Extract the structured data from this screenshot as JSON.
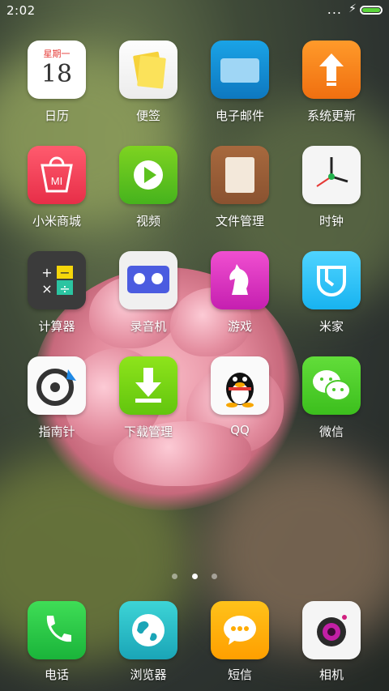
{
  "status_bar": {
    "time": "2:02",
    "signal_dots": "...",
    "charging_symbol": "⚡",
    "battery_level": 1.0,
    "battery_color": "#5bd43b"
  },
  "calendar_icon": {
    "weekday": "星期一",
    "day": "18"
  },
  "apps": [
    {
      "label": "日历"
    },
    {
      "label": "便签"
    },
    {
      "label": "电子邮件"
    },
    {
      "label": "系统更新"
    },
    {
      "label": "小米商城"
    },
    {
      "label": "视频"
    },
    {
      "label": "文件管理"
    },
    {
      "label": "时钟"
    },
    {
      "label": "计算器"
    },
    {
      "label": "录音机"
    },
    {
      "label": "游戏"
    },
    {
      "label": "米家"
    },
    {
      "label": "指南针"
    },
    {
      "label": "下载管理"
    },
    {
      "label": "QQ"
    },
    {
      "label": "微信"
    }
  ],
  "pager": {
    "count": 3,
    "active_index": 1
  },
  "dock": [
    {
      "label": "电话"
    },
    {
      "label": "浏览器"
    },
    {
      "label": "短信"
    },
    {
      "label": "相机"
    }
  ],
  "icon_glyphs": {
    "mall": "MI",
    "calc_plus": "+",
    "calc_minus": "−",
    "calc_times": "×",
    "calc_divide": "÷"
  }
}
